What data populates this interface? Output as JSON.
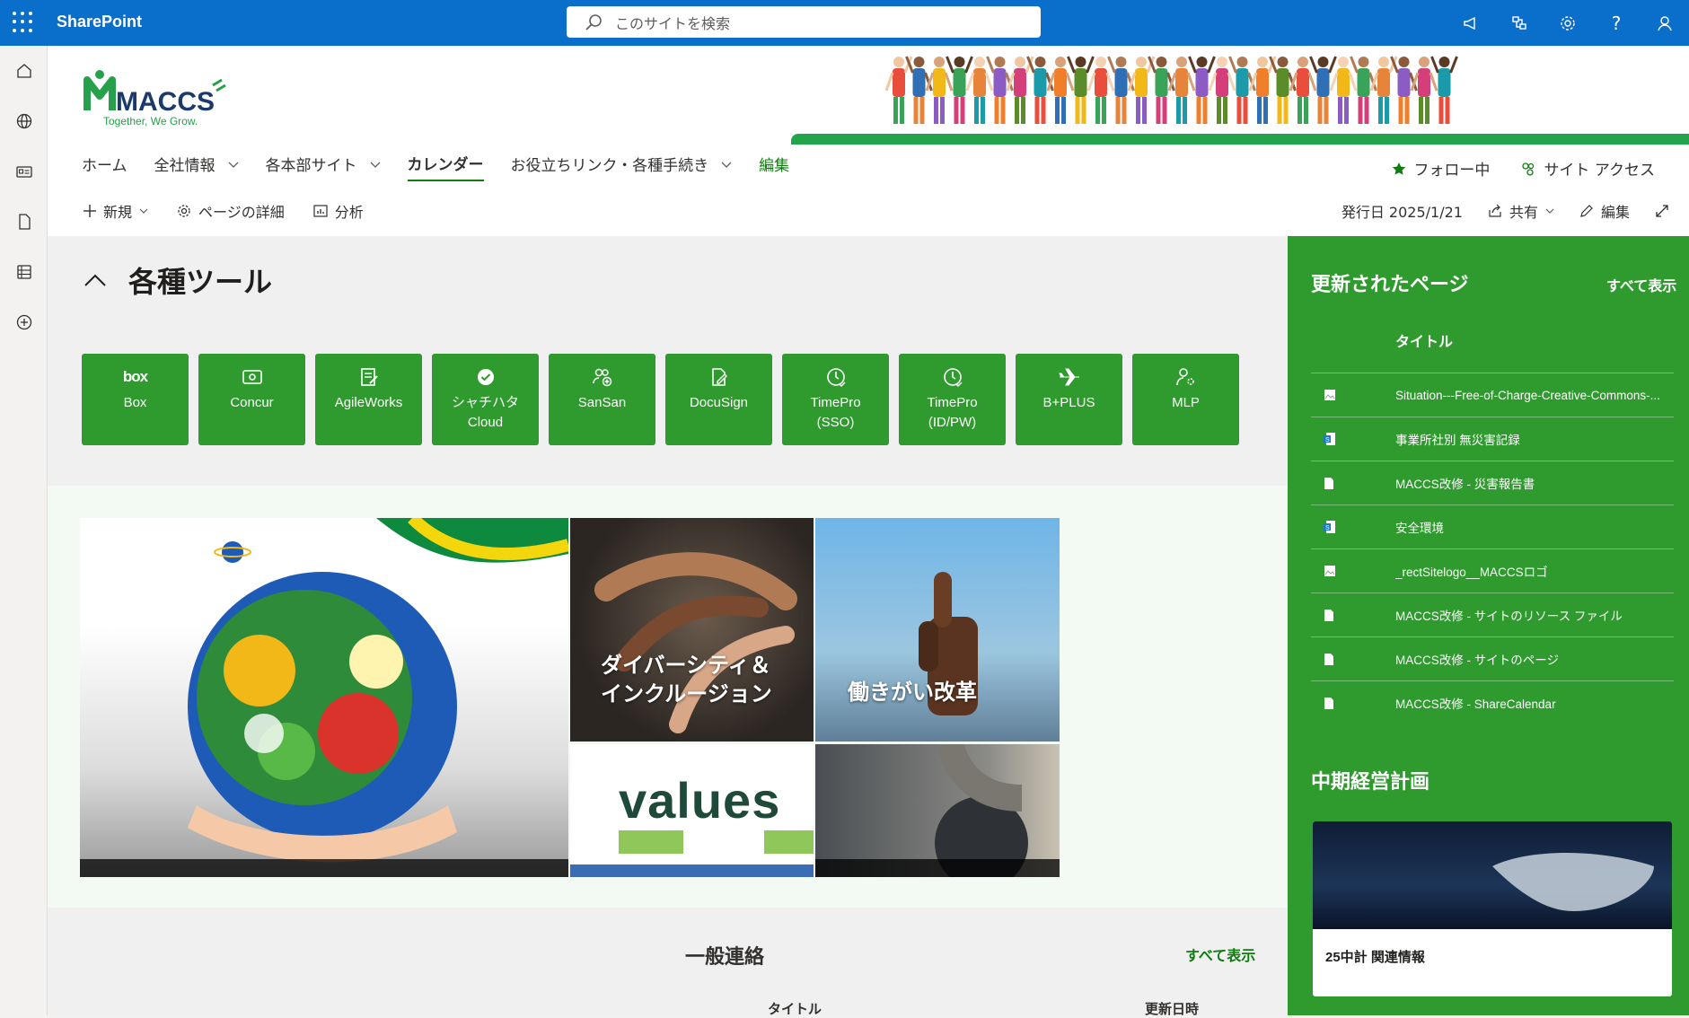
{
  "suitebar": {
    "app_name": "SharePoint",
    "search_placeholder": "このサイトを検索",
    "icons": [
      "megaphone-icon",
      "share-link-icon",
      "gear-icon",
      "help-icon",
      "person-icon"
    ]
  },
  "leftrail": {
    "icons": [
      "home-icon",
      "globe-icon",
      "news-icon",
      "file-icon",
      "list-icon",
      "add-circle-icon"
    ]
  },
  "header": {
    "logo_text": "MACCS",
    "logo_tagline": "Together, We Grow.",
    "nav": [
      {
        "label": "ホーム",
        "chevron": false
      },
      {
        "label": "全社情報",
        "chevron": true
      },
      {
        "label": "各本部サイト",
        "chevron": true
      },
      {
        "label": "カレンダー",
        "chevron": false,
        "active": true
      },
      {
        "label": "お役立ちリンク・各種手続き",
        "chevron": true
      }
    ],
    "nav_edit": "編集",
    "follow": "フォロー中",
    "site_access": "サイト アクセス"
  },
  "commandbar": {
    "new": "新規",
    "page_details": "ページの詳細",
    "analytics": "分析",
    "published": "発行日 2025/1/21",
    "share": "共有",
    "edit": "編集"
  },
  "tools_section": {
    "title": "各種ツール",
    "tools": [
      {
        "icon": "box-logo",
        "label": "Box",
        "label2": ""
      },
      {
        "icon": "concur-icon",
        "label": "Concur",
        "label2": ""
      },
      {
        "icon": "agileworks-icon",
        "label": "AgileWorks",
        "label2": ""
      },
      {
        "icon": "badge-check-icon",
        "label": "シャチハタ",
        "label2": "Cloud"
      },
      {
        "icon": "people-add-icon",
        "label": "SanSan",
        "label2": ""
      },
      {
        "icon": "document-sign-icon",
        "label": "DocuSign",
        "label2": ""
      },
      {
        "icon": "clock-icon",
        "label": "TimePro",
        "label2": "(SSO)"
      },
      {
        "icon": "clock-icon",
        "label": "TimePro",
        "label2": "(ID/PW)"
      },
      {
        "icon": "airplane-icon",
        "label": "B+PLUS",
        "label2": ""
      },
      {
        "icon": "person-settings-icon",
        "label": "MLP",
        "label2": ""
      }
    ]
  },
  "hero": {
    "tiles": [
      {
        "caption": ""
      },
      {
        "caption": "ダイバーシティ＆インクルージョン"
      },
      {
        "caption": "働きがい改革"
      },
      {
        "caption": "values"
      },
      {
        "caption": ""
      }
    ]
  },
  "news": {
    "title": "一般連絡",
    "see_all": "すべて表示",
    "col_title": "タイトル",
    "col_updated": "更新日時"
  },
  "updated_pages": {
    "title": "更新されたページ",
    "see_all": "すべて表示",
    "col_title": "タイトル",
    "rows": [
      {
        "icon": "image-file-icon",
        "title": "Situation---Free-of-Charge-Creative-Commons-..."
      },
      {
        "icon": "sway-file-icon",
        "title": "事業所社別 無災害記録"
      },
      {
        "icon": "page-file-icon",
        "title": "MACCS改修 - 災害報告書"
      },
      {
        "icon": "sway-file-icon",
        "title": "安全環境"
      },
      {
        "icon": "image-file-icon",
        "title": "_rectSitelogo__MACCSロゴ"
      },
      {
        "icon": "page-file-icon",
        "title": "MACCS改修 - サイトのリソース ファイル"
      },
      {
        "icon": "page-file-icon",
        "title": "MACCS改修 - サイトのページ"
      },
      {
        "icon": "page-file-icon",
        "title": "MACCS改修 - ShareCalendar"
      }
    ]
  },
  "midterm": {
    "title": "中期経営計画",
    "card_label": "25中計 関連情報"
  },
  "colors": {
    "suitebar": "#0a6fca",
    "brand_green": "#2f9a2d",
    "accent_green": "#107c10"
  }
}
